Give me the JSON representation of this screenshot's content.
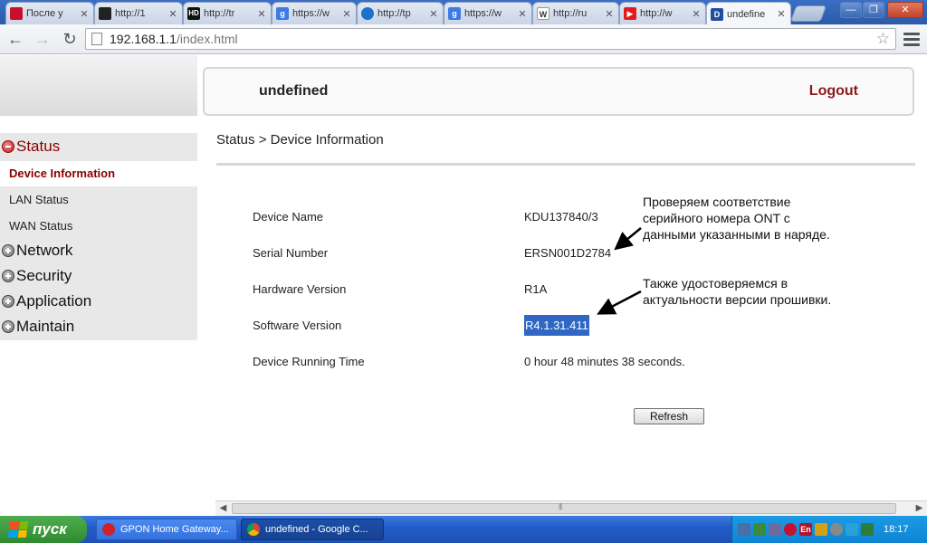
{
  "browser": {
    "tabs": [
      {
        "title": "После у",
        "icon": "opera-icon",
        "color": "#c8102e"
      },
      {
        "title": "http://1",
        "icon": "incognito-icon",
        "color": "#222222"
      },
      {
        "title": "http://tr",
        "icon": "hd-icon",
        "color": "#111111"
      },
      {
        "title": "https://w",
        "icon": "google-icon",
        "color": "#3b7be3"
      },
      {
        "title": "http://tp",
        "icon": "tplink-icon",
        "color": "#1a73c8"
      },
      {
        "title": "https://w",
        "icon": "google-icon",
        "color": "#3b7be3"
      },
      {
        "title": "http://ru",
        "icon": "wikipedia-icon",
        "color": "#333333"
      },
      {
        "title": "http://w",
        "icon": "youtube-icon",
        "color": "#e21c1c"
      },
      {
        "title": "undefine",
        "icon": "d-link-icon",
        "color": "#1f4f9e",
        "active": true
      }
    ],
    "close_glyph": "✕",
    "address": {
      "host": "192.168.1.1",
      "path": "/index.html"
    }
  },
  "page": {
    "header_title": "undefined",
    "logout": "Logout",
    "breadcrumb": "Status > Device Information",
    "menu": {
      "status": "Status",
      "status_items": [
        "Device Information",
        "LAN Status",
        "WAN Status"
      ],
      "groups": [
        "Network",
        "Security",
        "Application",
        "Maintain"
      ]
    },
    "info": [
      {
        "label": "Device Name",
        "value": "KDU137840/3"
      },
      {
        "label": "Serial Number",
        "value": "ERSN001D2784"
      },
      {
        "label": "Hardware Version",
        "value": "R1A"
      },
      {
        "label": "Software Version",
        "value": "R4.1.31.411"
      },
      {
        "label": "Device Running Time",
        "value": "0 hour 48 minutes 38 seconds."
      }
    ],
    "annotations": {
      "note1": [
        "Проверяем соответствие",
        "серийного номера ONT с",
        "данными указанными в наряде."
      ],
      "note2": [
        "Также удостоверяемся в",
        "актуальности версии прошивки."
      ]
    },
    "refresh_button": "Refresh"
  },
  "taskbar": {
    "start": "пуск",
    "tasks": [
      {
        "title": "GPON Home Gateway...",
        "icon": "opera-icon"
      },
      {
        "title": "undefined - Google C...",
        "icon": "chrome-icon"
      }
    ],
    "tray_lang": "En",
    "clock": "18:17"
  },
  "colors": {
    "accent_dark_red": "#8b0000",
    "selection_blue": "#3067c2",
    "xp_taskbar_blue": "#245dc8",
    "xp_start_green": "#2f8a2f"
  }
}
